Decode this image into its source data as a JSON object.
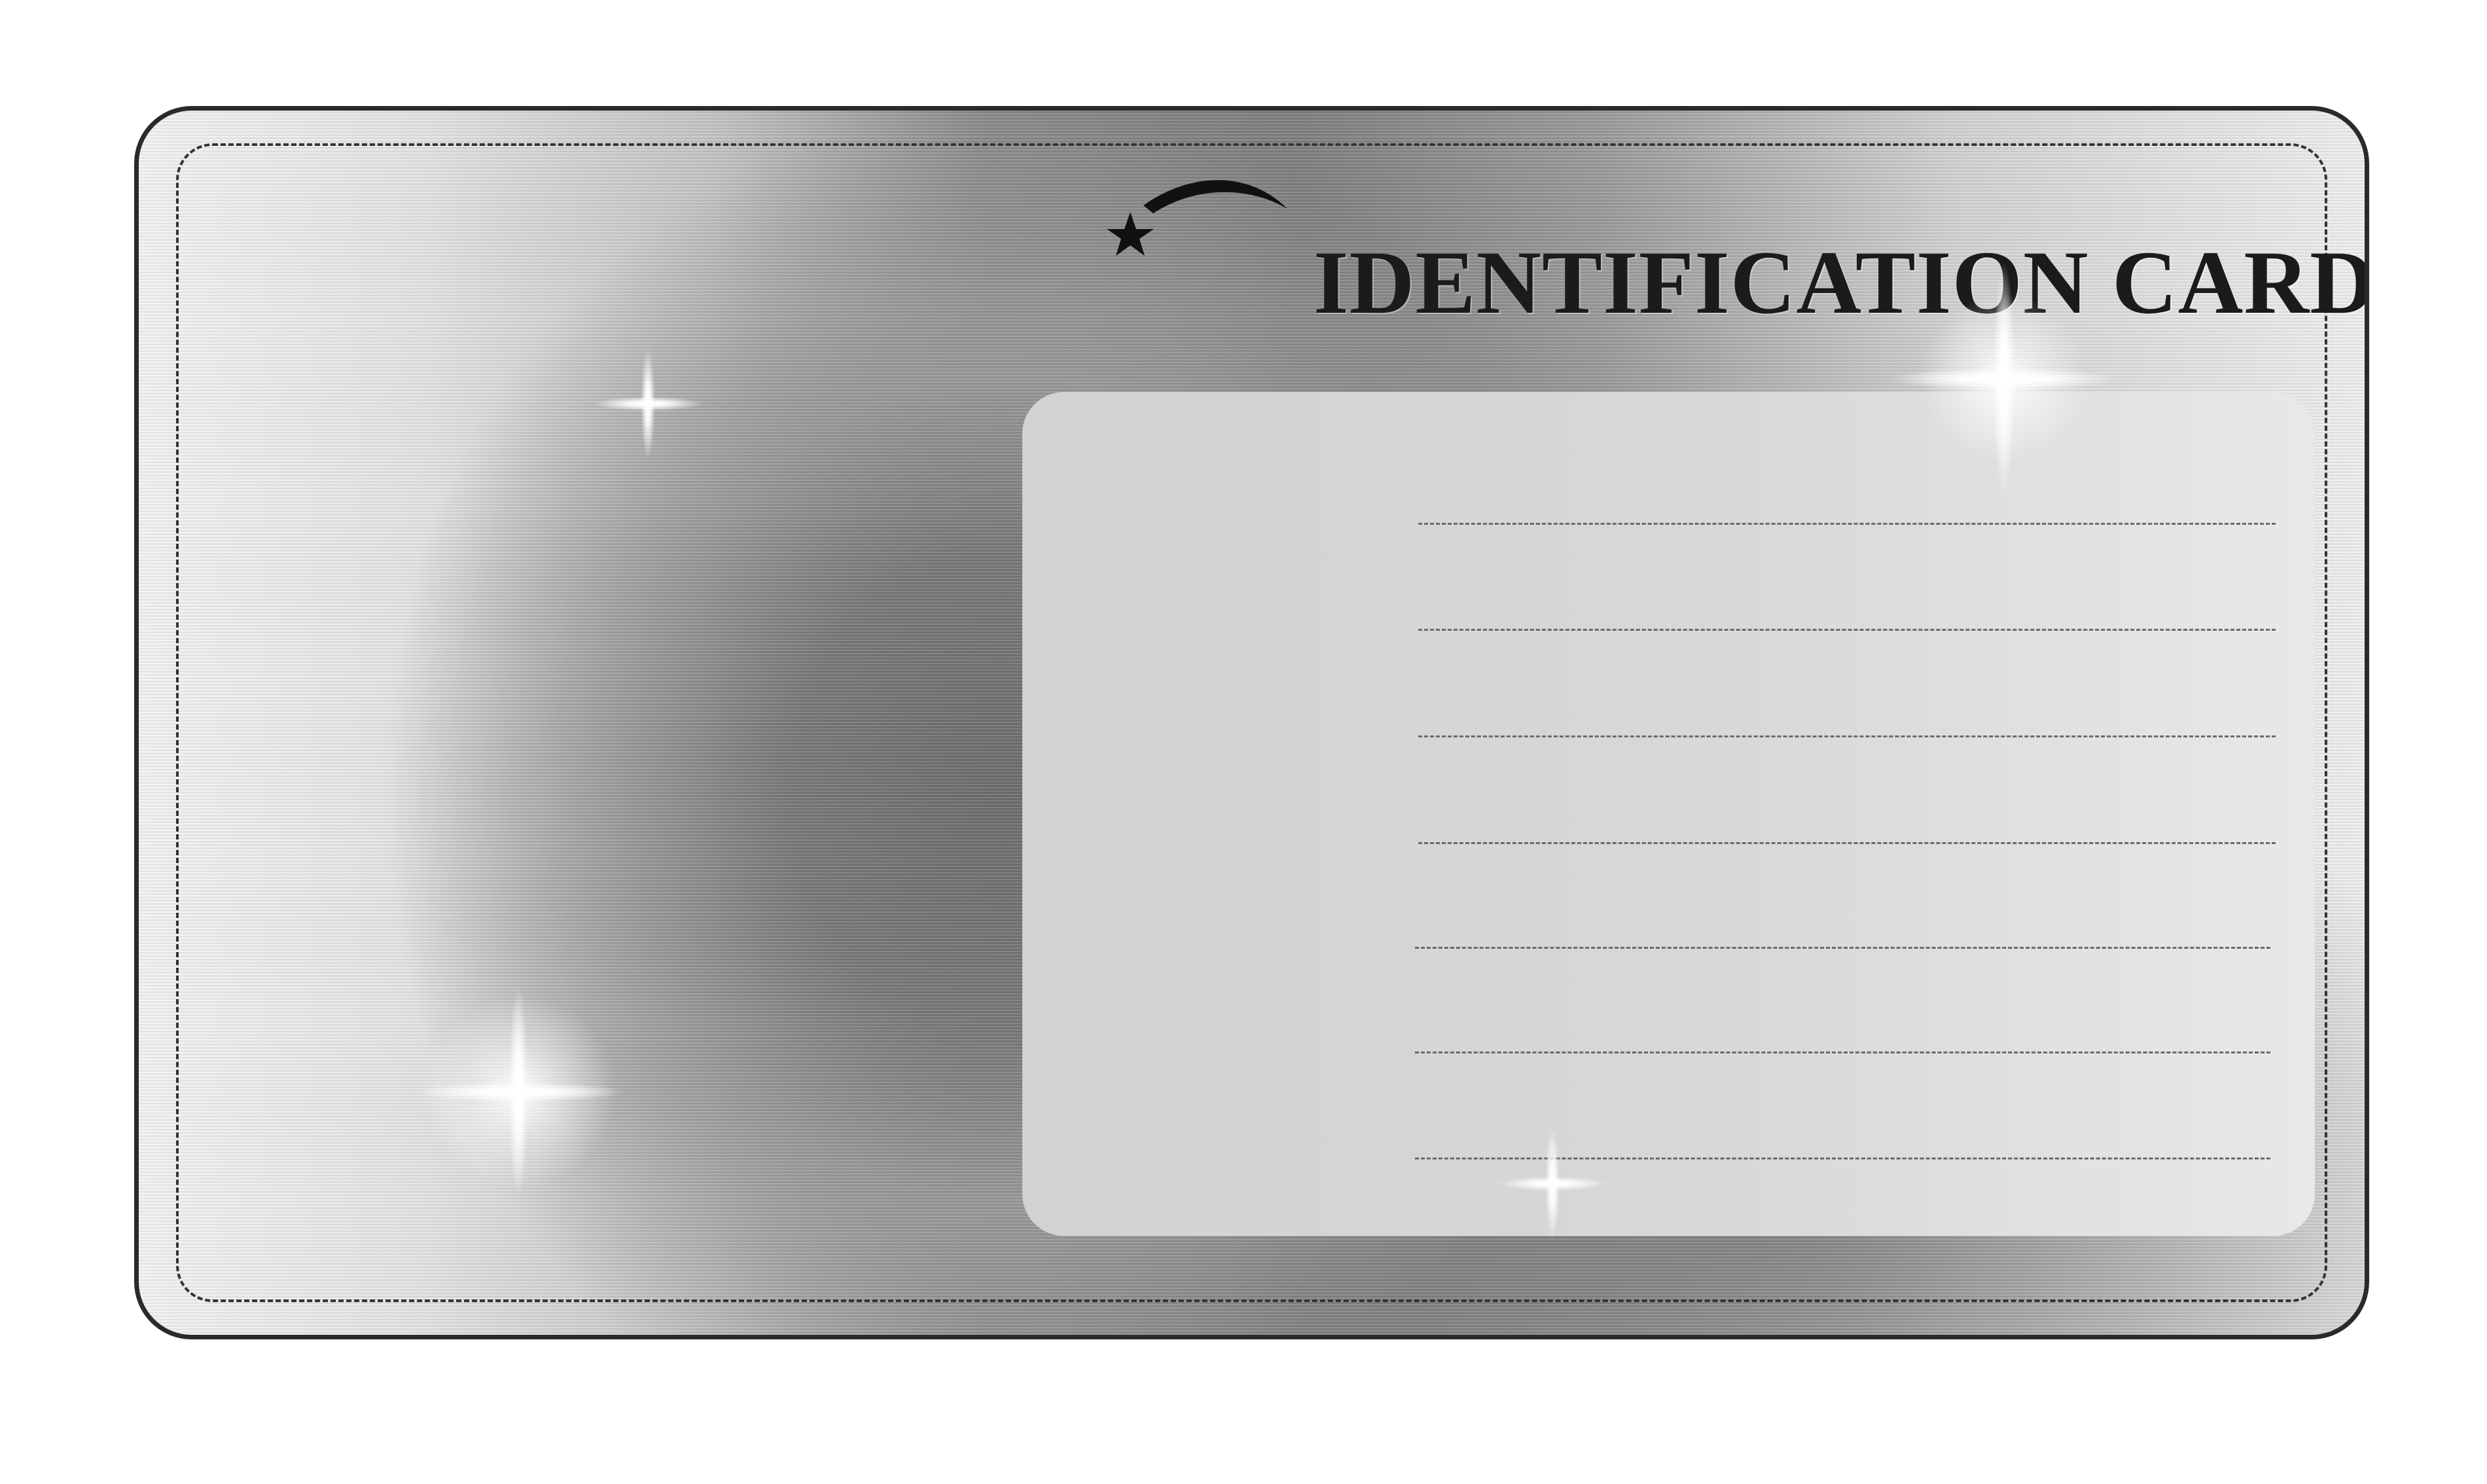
{
  "card": {
    "title": "IDENTIFICATION CARD",
    "logo_icon": "shooting-star-icon",
    "field_line_count": 7
  },
  "colors": {
    "title": "#1b1b1b",
    "panel": "#d6d6d6",
    "border": "#2a2a2a",
    "field_line": "#6a6a6a"
  },
  "decorations": {
    "sparkle_icon": "sparkle-icon",
    "sparkle_count": 4
  }
}
